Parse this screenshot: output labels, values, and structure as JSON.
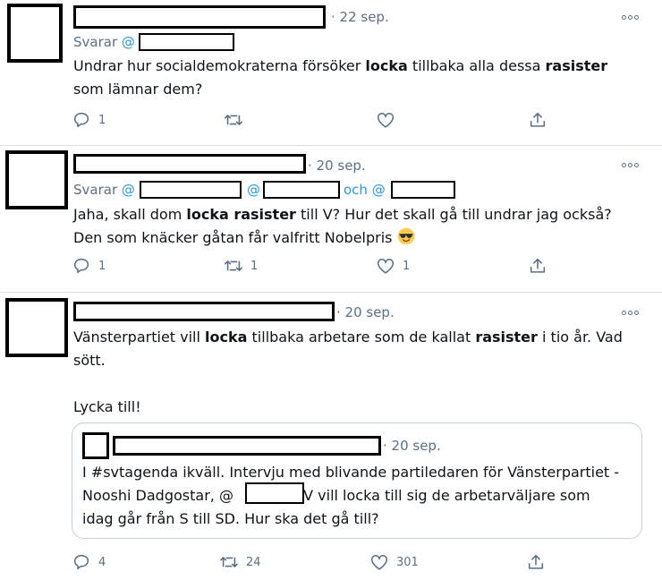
{
  "tweets": [
    {
      "date": "· 22 sep.",
      "reply_prefix": "Svarar",
      "reply_handles": [
        "@"
      ],
      "text_parts": [
        "Undrar hur socialdemokraterna försöker ",
        "locka",
        " tillbaka alla dessa ",
        "rasister",
        "\nsom lämnar dem?"
      ],
      "counts": {
        "reply": "1",
        "retweet": "",
        "like": "",
        "share": ""
      }
    },
    {
      "date": "· 20 sep.",
      "reply_prefix": "Svarar",
      "reply_handles": [
        "@",
        "@",
        "och @"
      ],
      "text_parts": [
        "Jaha, skall dom ",
        "locka rasister",
        " till V? Hur det skall gå till undrar jag också?\nDen som knäcker gåtan får valfritt Nobelpris "
      ],
      "emoji": "sunglasses-emoji",
      "counts": {
        "reply": "1",
        "retweet": "1",
        "like": "1",
        "share": ""
      }
    },
    {
      "date": "· 20 sep.",
      "text_parts": [
        "Vänsterpartiet vill ",
        "locka",
        " tillbaka arbetare som de kallat ",
        "rasister",
        " i tio år. Vad\nsött.\n\nLycka till!"
      ],
      "quote": {
        "date": "· 20 sep.",
        "text_1": "I #svtagenda ikväll. Intervju med blivande partiledaren för Vänsterpartiet -\nNooshi Dadgostar, @",
        "text_2": ". V vill locka till sig de arbetarväljare som\nidag går från S till SD. Hur ska det gå till?"
      },
      "counts": {
        "reply": "4",
        "retweet": "24",
        "like": "301",
        "share": ""
      }
    }
  ],
  "colors": {
    "text": "#0f1419",
    "muted": "#5b7083",
    "link": "#1d9bf0",
    "divider": "#dbe0e4",
    "redaction": "#000000"
  },
  "icons": [
    "more-options-icon",
    "reply-icon",
    "retweet-icon",
    "like-icon",
    "share-icon"
  ]
}
